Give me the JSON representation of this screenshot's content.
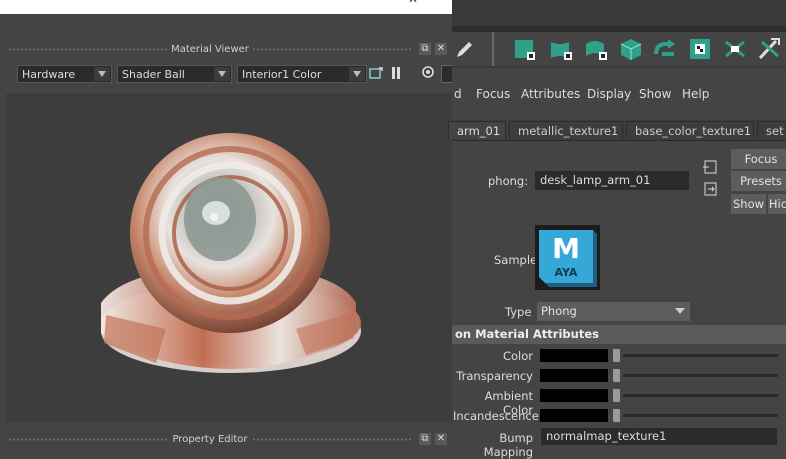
{
  "window_controls": {
    "minimize": "—",
    "close": "✕"
  },
  "material_viewer": {
    "title": "Material Viewer",
    "float_label": "⧉",
    "close_label": "✕",
    "renderer": "Hardware",
    "geometry": "Shader Ball",
    "environment": "Interior1 Color"
  },
  "property_editor": {
    "title": "Property Editor"
  },
  "attribute_editor": {
    "menu": [
      "d",
      "Focus",
      "Attributes",
      "Display",
      "Show",
      "Help"
    ],
    "tabs": [
      "arm_01",
      "metallic_texture1",
      "base_color_texture1",
      "set"
    ],
    "node_type_label": "phong:",
    "node_name": "desk_lamp_arm_01",
    "buttons": {
      "focus": "Focus",
      "presets": "Presets",
      "show": "Show",
      "hide": "Hic"
    },
    "sample_label": "Sample",
    "sample_logo": {
      "letter": "M",
      "text": "AYA"
    },
    "type_label": "Type",
    "type_value": "Phong",
    "section_title": "on Material Attributes",
    "attributes": [
      {
        "label": "Color",
        "value": "#000000"
      },
      {
        "label": "Transparency",
        "value": "#000000"
      },
      {
        "label": "Ambient Color",
        "value": "#000000"
      },
      {
        "label": "Incandescence",
        "value": "#000000"
      }
    ],
    "bump_label": "Bump Mapping",
    "bump_value": "normalmap_texture1"
  },
  "shelf_icons": [
    "pencil-icon",
    "poly-cube-select-icon",
    "poly-half-cylinder-icon",
    "poly-shell-icon",
    "poly-cube-icon",
    "connect-arrows-icon",
    "uv-grid-icon",
    "checker-x-icon",
    "no-tool-icon"
  ],
  "colors": {
    "accent": "#2fa08a",
    "bg": "#444444",
    "field": "#2b2b2b"
  }
}
